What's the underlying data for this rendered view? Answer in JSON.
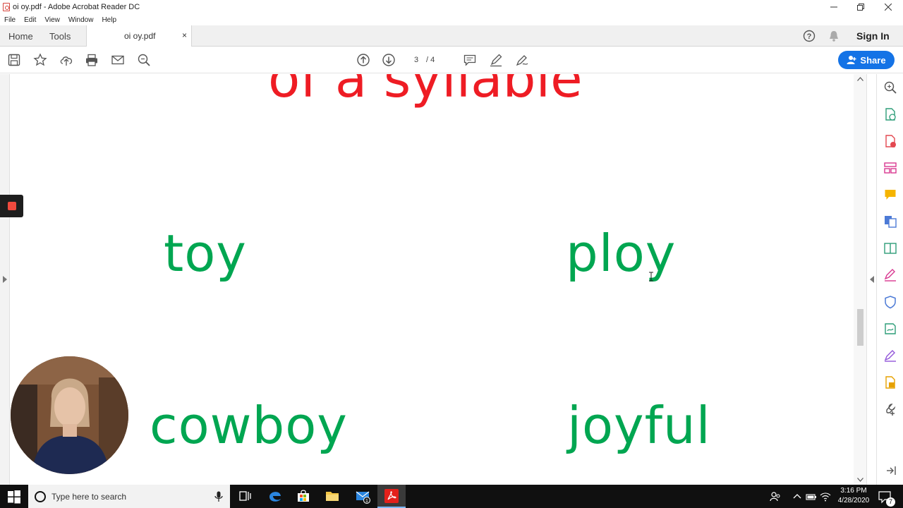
{
  "window": {
    "title": "oi oy.pdf - Adobe Acrobat Reader DC"
  },
  "menu": {
    "items": [
      "File",
      "Edit",
      "View",
      "Window",
      "Help"
    ]
  },
  "tabs": {
    "home": "Home",
    "tools": "Tools",
    "document": "oi oy.pdf",
    "close": "×"
  },
  "header": {
    "sign_in": "Sign In"
  },
  "toolbar": {
    "page_current": "3",
    "page_total": "/ 4",
    "share_label": "Share"
  },
  "document": {
    "heading": "of a syllable",
    "words": [
      "toy",
      "ploy",
      "cowboy",
      "joyful"
    ]
  },
  "taskbar": {
    "search_placeholder": "Type here to search",
    "time": "3:16 PM",
    "date": "4/28/2020",
    "notification_count": "7",
    "mail_badge": "1"
  },
  "colors": {
    "accent": "#1473e6",
    "heading": "#ee1c24",
    "words": "#00a651"
  }
}
